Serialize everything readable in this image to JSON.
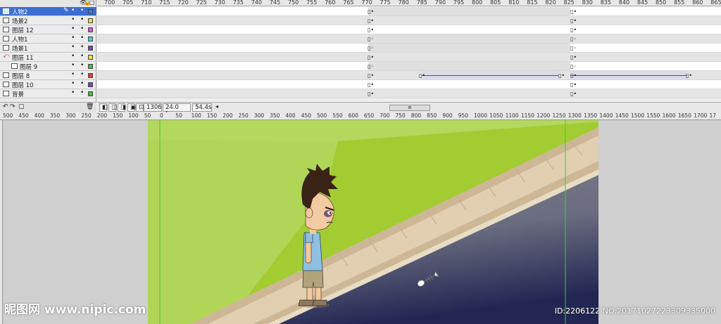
{
  "layers": [
    {
      "name": "人物2",
      "color": "#4a78c0",
      "selected": true
    },
    {
      "name": "场景2",
      "color": "#e8e040"
    },
    {
      "name": "图层 12",
      "color": "#e050d0"
    },
    {
      "name": "人物1",
      "color": "#40d0e0"
    },
    {
      "name": "场景1",
      "color": "#8040c0"
    },
    {
      "name": "图层 11",
      "color": "#e8e040"
    },
    {
      "name": "图层 9",
      "color": "#40c040"
    },
    {
      "name": "图层 8",
      "color": "#e04040"
    },
    {
      "name": "图层 10",
      "color": "#8040c0"
    },
    {
      "name": "背景",
      "color": "#40c040"
    }
  ],
  "frame_ruler": [
    "700",
    "705",
    "710",
    "715",
    "720",
    "725",
    "730",
    "735",
    "740",
    "745",
    "750",
    "755",
    "760",
    "765",
    "770",
    "775",
    "780",
    "785",
    "790",
    "795",
    "800",
    "805",
    "810",
    "815",
    "820",
    "825",
    "830",
    "835",
    "840",
    "845",
    "850",
    "855",
    "860",
    "865"
  ],
  "status": {
    "current_frame": "1306",
    "fps": "24.0 fps",
    "time": "54.4s",
    "scroll_thumb": "≡"
  },
  "stage_ruler": [
    "500",
    "450",
    "400",
    "350",
    "300",
    "250",
    "200",
    "150",
    "100",
    "50",
    "0",
    "50",
    "100",
    "150",
    "200",
    "250",
    "300",
    "350",
    "400",
    "450",
    "500",
    "550",
    "600",
    "650",
    "700",
    "750",
    "800",
    "850",
    "900",
    "950",
    "1000",
    "1050",
    "1100",
    "1150",
    "1200",
    "1250",
    "1300",
    "1350",
    "1400",
    "1450",
    "1500",
    "1550",
    "1600",
    "1650",
    "1700",
    "17"
  ],
  "watermark": {
    "left": "昵图网 www.nipic.com",
    "right": "ID:2206122 NO:20171027223309335000"
  },
  "colors": {
    "grass_top": "#b4d75e",
    "grass_mid": "#a3cc33",
    "curb": "#e2cfb2",
    "road_dark": "#232652",
    "selection": "#3c6fd1"
  }
}
